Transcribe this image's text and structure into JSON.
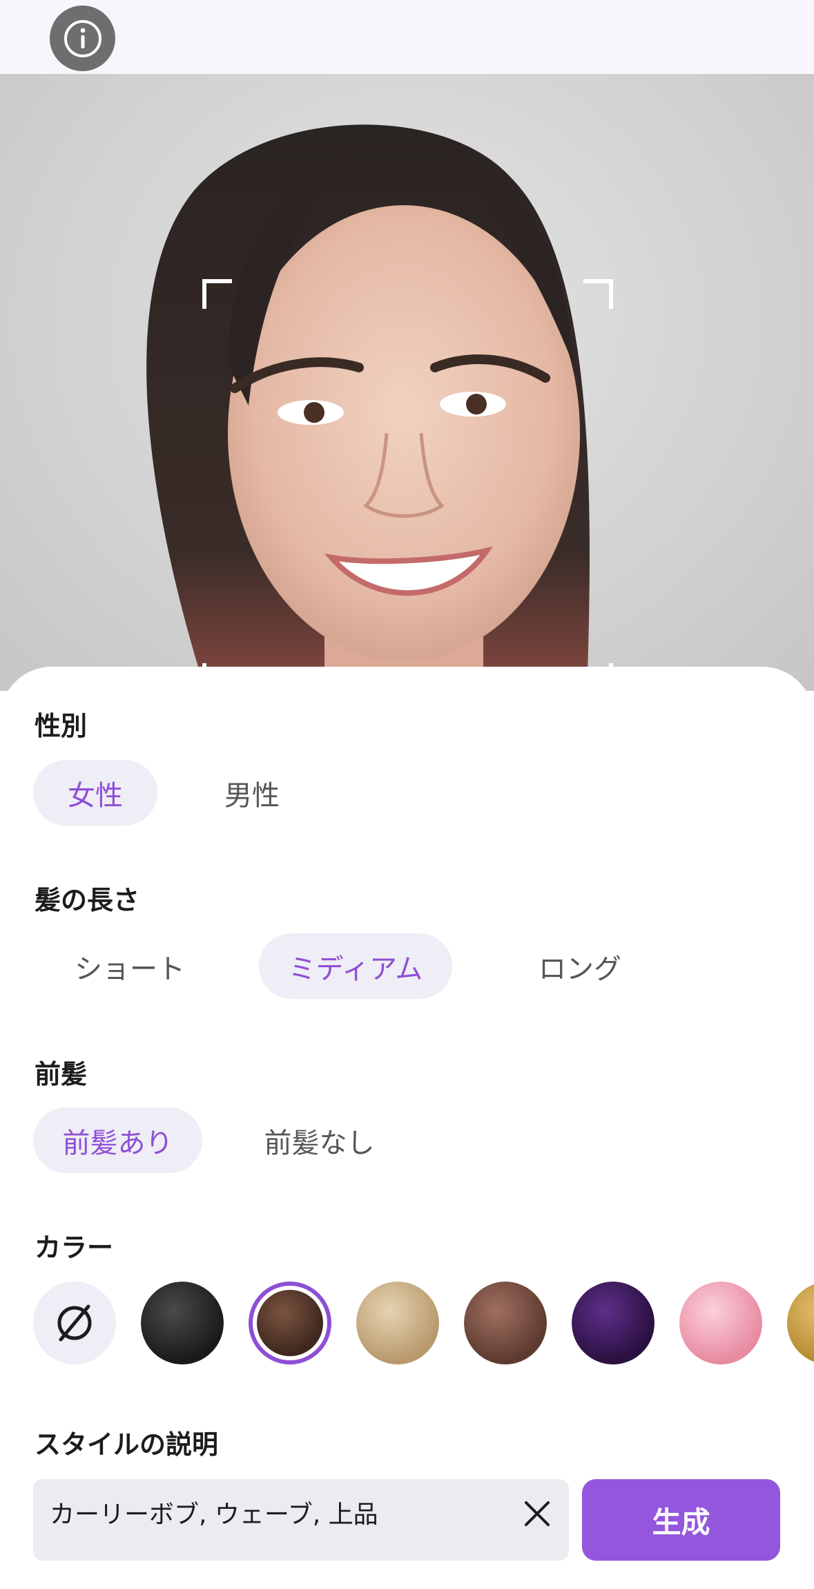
{
  "header": {
    "info_icon": "info-icon"
  },
  "photo": {
    "subject": "portrait-photo"
  },
  "gender": {
    "label": "性別",
    "options": [
      "女性",
      "男性"
    ],
    "selected": "女性"
  },
  "hair_length": {
    "label": "髪の長さ",
    "options": [
      "ショート",
      "ミディアム",
      "ロング"
    ],
    "selected": "ミディアム"
  },
  "bangs": {
    "label": "前髪",
    "options": [
      "前髪あり",
      "前髪なし"
    ],
    "selected": "前髪あり"
  },
  "color": {
    "label": "カラー",
    "swatches": [
      {
        "name": "none",
        "hex": "#efedf5"
      },
      {
        "name": "black",
        "hex": "#2a2a2a"
      },
      {
        "name": "brown",
        "hex": "#5a3a2a"
      },
      {
        "name": "blonde-beige",
        "hex": "#cfb48c"
      },
      {
        "name": "ash-brown",
        "hex": "#7d5548"
      },
      {
        "name": "purple",
        "hex": "#3d1b5e"
      },
      {
        "name": "pink",
        "hex": "#f0a7b8"
      },
      {
        "name": "gold",
        "hex": "#c9a24b"
      }
    ],
    "selected_index": 2,
    "accent": "#8e4fd6"
  },
  "style_description": {
    "label": "スタイルの説明",
    "value": "カーリーボブ, ウェーブ, 上品",
    "clear_icon": "close-icon"
  },
  "generate_button": {
    "label": "生成",
    "color": "#9456dc"
  }
}
